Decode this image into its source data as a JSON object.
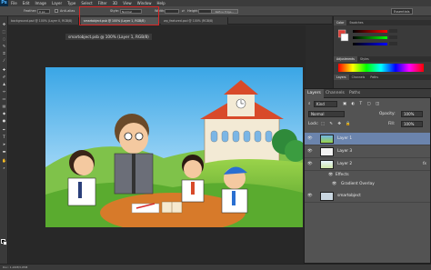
{
  "menubar": {
    "app_logo": "Ps",
    "items": [
      "File",
      "Edit",
      "Image",
      "Layer",
      "Type",
      "Select",
      "Filter",
      "3D",
      "View",
      "Window",
      "Help"
    ]
  },
  "options": {
    "feather_label": "Feather:",
    "feather_value": "0 px",
    "antialias_label": "Anti-alias",
    "style_label": "Style:",
    "style_value": "Normal",
    "width_label": "Width:",
    "height_label": "Height:",
    "refine_edge": "Refine Edge...",
    "workspace": "Essentials"
  },
  "tabs": [
    "background.psd @ 100% (Layer 0, RGB/8)",
    "smartobject.psb @ 100% (Layer 1, RGB/8)",
    "wp_featured.psd @ 100% (RGB/8)"
  ],
  "document": {
    "floating_label": "smartobject.psb @ 100% (Layer 1, RGB/8)"
  },
  "status": {
    "text": "Doc: 1,22M/3,05M"
  },
  "dock": {
    "color_tabs": [
      "Color",
      "Swatches"
    ],
    "adjust_tabs": [
      "Adjustments",
      "Styles"
    ],
    "lower_tabs": [
      "Layers",
      "Channels",
      "Paths"
    ]
  },
  "layers_panel": {
    "tabs": [
      "Layers",
      "Channels",
      "Paths"
    ],
    "filter": "Kind",
    "blend_mode": "Normal",
    "opacity_label": "Opacity:",
    "opacity_value": "100%",
    "lock_label": "Lock:",
    "fill_label": "Fill:",
    "fill_value": "100%",
    "layers": [
      {
        "name": "Layer 1",
        "selected": true
      },
      {
        "name": "Layer 3",
        "selected": false
      },
      {
        "name": "Layer 2",
        "selected": false,
        "fx": "fx"
      }
    ],
    "effects_label": "Effects",
    "effect_item": "Gradient Overlay",
    "last_layer": "smartobject"
  },
  "colors": {
    "accent_selection": "#6b84ad",
    "highlight_box": "#d92626"
  }
}
